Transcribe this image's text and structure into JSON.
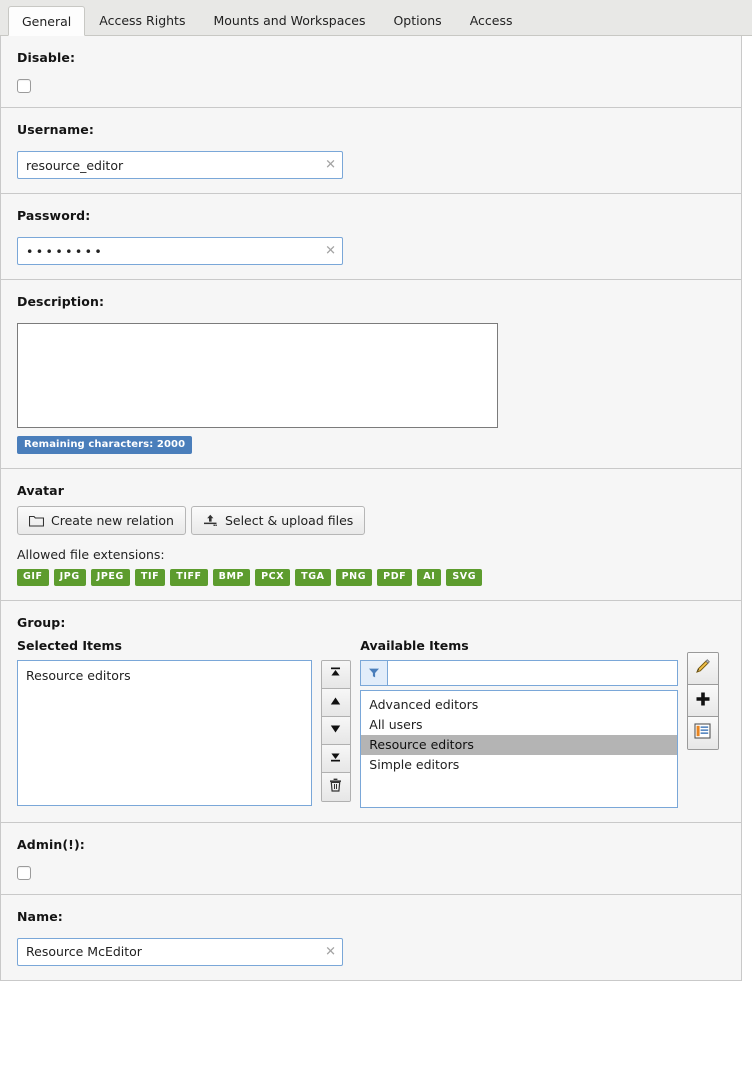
{
  "tabs": [
    {
      "label": "General",
      "active": true
    },
    {
      "label": "Access Rights",
      "active": false
    },
    {
      "label": "Mounts and Workspaces",
      "active": false
    },
    {
      "label": "Options",
      "active": false
    },
    {
      "label": "Access",
      "active": false
    }
  ],
  "sections": {
    "disable": {
      "label": "Disable:",
      "checked": false
    },
    "username": {
      "label": "Username:",
      "value": "resource_editor",
      "placeholder": "",
      "clear_icon": "clear-x-icon"
    },
    "password": {
      "label": "Password:",
      "value": "••••••••",
      "masked_length": 8,
      "clear_icon": "clear-x-icon"
    },
    "description": {
      "label": "Description:",
      "value": "",
      "placeholder": "",
      "remaining_badge": "Remaining characters: 2000",
      "remaining_count": 2000
    },
    "avatar": {
      "label": "Avatar",
      "create_button": "Create new relation",
      "create_icon": "folder-icon",
      "upload_button": "Select & upload files",
      "upload_icon": "upload-icon",
      "allowed_label": "Allowed file extensions:",
      "extensions": [
        "GIF",
        "JPG",
        "JPEG",
        "TIF",
        "TIFF",
        "BMP",
        "PCX",
        "TGA",
        "PNG",
        "PDF",
        "AI",
        "SVG"
      ]
    },
    "group": {
      "label": "Group:",
      "selected_header": "Selected Items",
      "available_header": "Available Items",
      "selected_items": [
        "Resource editors"
      ],
      "available_items": [
        "Advanced editors",
        "All users",
        "Resource editors",
        "Simple editors"
      ],
      "available_selected": "Resource editors",
      "filter_value": "",
      "filter_placeholder": "",
      "filter_icon": "funnel-icon",
      "move_buttons": [
        {
          "name": "move-to-top-button",
          "icon": "arrow-to-top-icon"
        },
        {
          "name": "move-up-button",
          "icon": "arrow-up-icon"
        },
        {
          "name": "move-down-button",
          "icon": "arrow-down-icon"
        },
        {
          "name": "move-to-bottom-button",
          "icon": "arrow-to-bottom-icon"
        },
        {
          "name": "remove-button",
          "icon": "trash-icon"
        }
      ],
      "side_buttons": [
        {
          "name": "edit-button",
          "icon": "pencil-icon"
        },
        {
          "name": "add-button",
          "icon": "plus-icon"
        },
        {
          "name": "list-button",
          "icon": "list-form-icon"
        }
      ]
    },
    "admin": {
      "label": "Admin(!):",
      "checked": false
    },
    "name": {
      "label": "Name:",
      "value": "Resource McEditor",
      "placeholder": "",
      "clear_icon": "clear-x-icon"
    }
  },
  "colors": {
    "accent_blue": "#4a7ebb",
    "input_border": "#7aa7d8",
    "badge_green": "#5d9c2e",
    "panel_bg": "#f6f6f6",
    "tabbar_bg": "#e8e8e6",
    "selection_gray": "#b4b4b4"
  }
}
